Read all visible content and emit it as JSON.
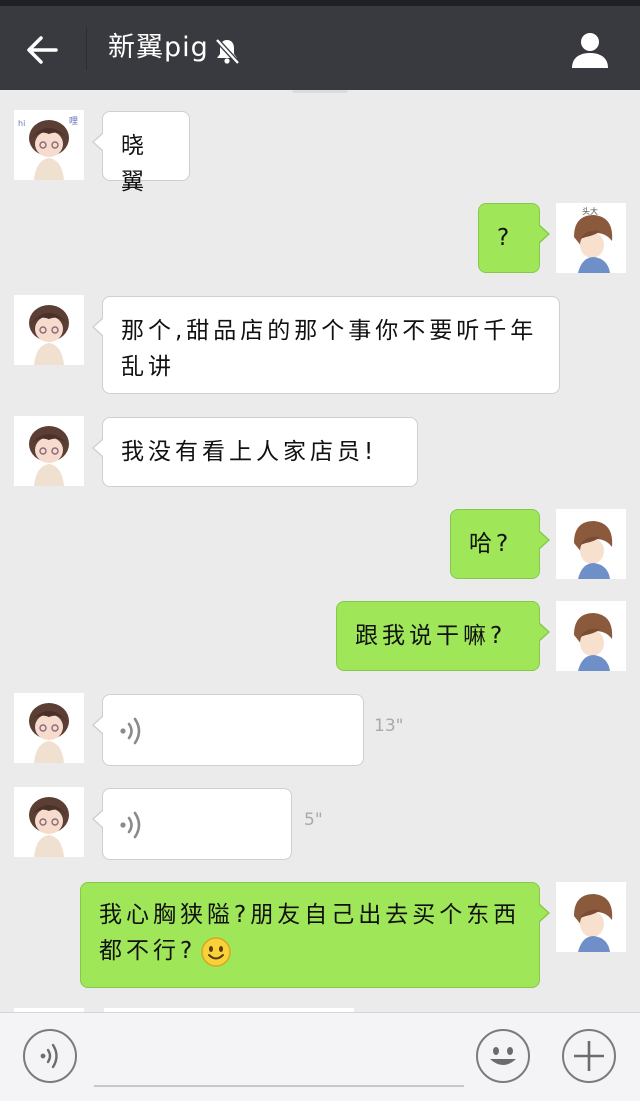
{
  "header": {
    "title": "新翼pig",
    "back_icon": "arrow-left-icon",
    "mute_icon": "bell-off-icon",
    "profile_icon": "person-icon"
  },
  "colors": {
    "header_bg": "#393a3f",
    "chat_bg": "#ebebeb",
    "outgoing_bubble": "#9fe658",
    "incoming_bubble": "#ffffff"
  },
  "messages": [
    {
      "side": "in",
      "type": "text",
      "text": "晓翼"
    },
    {
      "side": "out",
      "type": "text",
      "text": "?"
    },
    {
      "side": "in",
      "type": "text",
      "text": "那个,甜品店的那个事你不要听千年乱讲"
    },
    {
      "side": "in",
      "type": "text",
      "text": "我没有看上人家店员!"
    },
    {
      "side": "out",
      "type": "text",
      "text": "哈?"
    },
    {
      "side": "out",
      "type": "text",
      "text": "跟我说干嘛?"
    },
    {
      "side": "in",
      "type": "voice",
      "duration": "13\""
    },
    {
      "side": "in",
      "type": "voice",
      "duration": "5\""
    },
    {
      "side": "out",
      "type": "text",
      "text": "我心胸狭隘?朋友自己出去买个东西都不行?",
      "emoji": "smiley-face-icon"
    }
  ],
  "input_bar": {
    "voice_icon": "voice-mode-icon",
    "emoji_icon": "emoji-icon",
    "plus_icon": "plus-icon",
    "value": ""
  }
}
